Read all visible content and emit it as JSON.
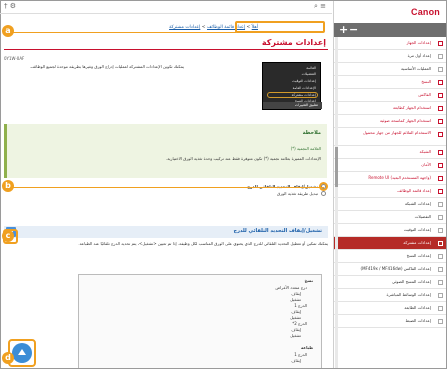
{
  "toolbar": {
    "left_icons": "† ⚙",
    "right_icons": "⌕ ≡"
  },
  "breadcrumb": {
    "home": "أهلاً",
    "sep": ">",
    "part1": "إعداد قائمة الوظائف",
    "part2": "إعدادات مشتركة"
  },
  "page_title": "إعدادات مشتركة",
  "doc_id": "0Y1W-0AF",
  "intro": "يمكنك تكوين الإعدادات المشتركة لعمليات إدراج الورق وغيرها بطريقة موحدة لجميع الوظائف.",
  "menu_image": {
    "items": [
      "القائمة",
      "التفضيلات",
      "إعدادات التوقيت",
      "الإعدادات العامة",
      "إعدادات مشتركة",
      "إعدادات النسخ"
    ],
    "bottom": "تطبيق التغييرات"
  },
  "note": {
    "title": "ملاحظة",
    "subtitle": "العلامة النجمية (*)",
    "body": "الإعدادات المميزة بعلامة نجمية (*) تكون متوفرة فقط عند تركيب وحدة تغذية الورق الاختيارية."
  },
  "links": {
    "l1": "تشغيل/إيقاف التحديد التلقائي للدرج",
    "l2": "تبديل طريقة تغذية الورق"
  },
  "section": {
    "title": "تشغيل/إيقاف التحديد التلقائي للدرج"
  },
  "section_body": "يمكنك تمكين أو تعطيل التحديد التلقائي للدرج الذي يحتوي على الورق المناسب لكل وظيفة. إذا تم تعيين <تشغيل>، يتم تحديد الدرج تلقائيًا عند الطباعة.",
  "code": {
    "l1": "نسخ",
    "l2": "درج متعدد الأغراض",
    "l3": "إيقاف",
    "l4": "تشغيل",
    "l5": "الدرج 1",
    "l6": "إيقاف",
    "l7": "تشغيل",
    "l8": "الدرج 2*",
    "l9": "إيقاف",
    "l10": "تشغيل",
    "l11": "طباعة",
    "l12": "الدرج 1",
    "l13": "إيقاف"
  },
  "sidebar": {
    "logo": "Canon",
    "items": [
      {
        "label": "إعدادات الجهاز",
        "style": "h1"
      },
      {
        "label": "إعداد أول مرة",
        "style": ""
      },
      {
        "label": "العمليات الأساسية",
        "style": ""
      },
      {
        "label": "النسخ",
        "style": "h1"
      },
      {
        "label": "الفاكس",
        "style": "h1"
      },
      {
        "label": "استخدام الجهاز كطابعة",
        "style": "h1"
      },
      {
        "label": "استخدام الجهاز كماسحة ضوئية",
        "style": "h1"
      },
      {
        "label": "الاستخدام الملائم للجهاز من جهاز محمول",
        "style": "h1 tall"
      },
      {
        "label": "الشبكة",
        "style": "h1"
      },
      {
        "label": "الأمان",
        "style": "h1"
      },
      {
        "label": "(واجهة المستخدم البعيد) Remote UI",
        "style": "h1"
      },
      {
        "label": "إعداد قائمة الوظائف",
        "style": "h1"
      },
      {
        "label": "إعدادات الشبكة",
        "style": ""
      },
      {
        "label": "التفضيلات",
        "style": ""
      },
      {
        "label": "إعدادات التوقيت",
        "style": ""
      },
      {
        "label": "إعدادات مشتركة",
        "style": "sel"
      },
      {
        "label": "إعدادات النسخ",
        "style": ""
      },
      {
        "label": "إعدادات الفاكس (MF419x / MF416dw)",
        "style": ""
      },
      {
        "label": "إعدادات المسح الضوئي",
        "style": ""
      },
      {
        "label": "إعدادات الوسائط المباشرة",
        "style": ""
      },
      {
        "label": "إعدادات الطابعة",
        "style": ""
      },
      {
        "label": "إعدادات الضبط",
        "style": ""
      }
    ]
  },
  "markers": {
    "a": "a",
    "b": "b",
    "c": "c",
    "d": "d"
  },
  "colors": {
    "accent": "#c8102e",
    "highlight": "#f0a020",
    "link": "#1a5ea8"
  }
}
